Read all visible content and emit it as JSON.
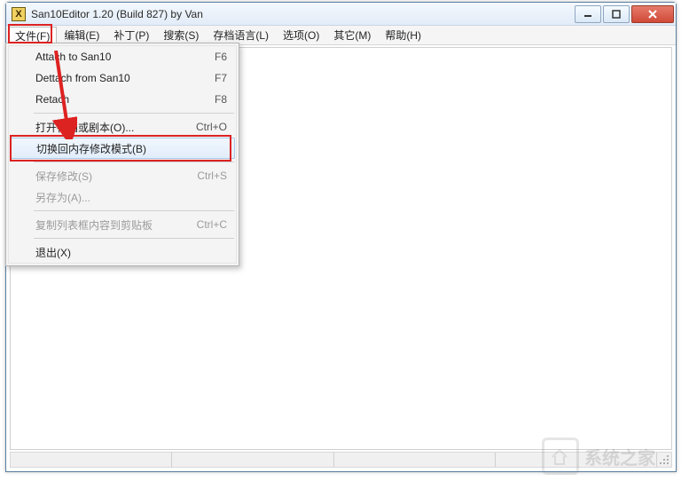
{
  "window": {
    "title": "San10Editor 1.20 (Build 827) by Van",
    "app_icon_glyph": "X"
  },
  "menubar": [
    {
      "label": "文件(F)",
      "selected": true
    },
    {
      "label": "编辑(E)",
      "selected": false
    },
    {
      "label": "补丁(P)",
      "selected": false
    },
    {
      "label": "搜索(S)",
      "selected": false
    },
    {
      "label": "存档语言(L)",
      "selected": false
    },
    {
      "label": "选项(O)",
      "selected": false
    },
    {
      "label": "其它(M)",
      "selected": false
    },
    {
      "label": "帮助(H)",
      "selected": false
    }
  ],
  "dropdown": [
    {
      "type": "item",
      "label": "Attach to San10",
      "shortcut": "F6",
      "enabled": true,
      "hover": false
    },
    {
      "type": "item",
      "label": "Dettach from San10",
      "shortcut": "F7",
      "enabled": true,
      "hover": false
    },
    {
      "type": "item",
      "label": "Retach",
      "shortcut": "F8",
      "enabled": true,
      "hover": false
    },
    {
      "type": "sep"
    },
    {
      "type": "item",
      "label": "打开存档或剧本(O)...",
      "shortcut": "Ctrl+O",
      "enabled": true,
      "hover": false
    },
    {
      "type": "item",
      "label": "切换回内存修改模式(B)",
      "shortcut": "",
      "enabled": true,
      "hover": true
    },
    {
      "type": "sep"
    },
    {
      "type": "item",
      "label": "保存修改(S)",
      "shortcut": "Ctrl+S",
      "enabled": false,
      "hover": false
    },
    {
      "type": "item",
      "label": "另存为(A)...",
      "shortcut": "",
      "enabled": false,
      "hover": false
    },
    {
      "type": "sep"
    },
    {
      "type": "item",
      "label": "复制列表框内容到剪贴板",
      "shortcut": "Ctrl+C",
      "enabled": false,
      "hover": false
    },
    {
      "type": "sep"
    },
    {
      "type": "item",
      "label": "退出(X)",
      "shortcut": "",
      "enabled": true,
      "hover": false
    }
  ],
  "watermark": {
    "text": "系统之家"
  }
}
